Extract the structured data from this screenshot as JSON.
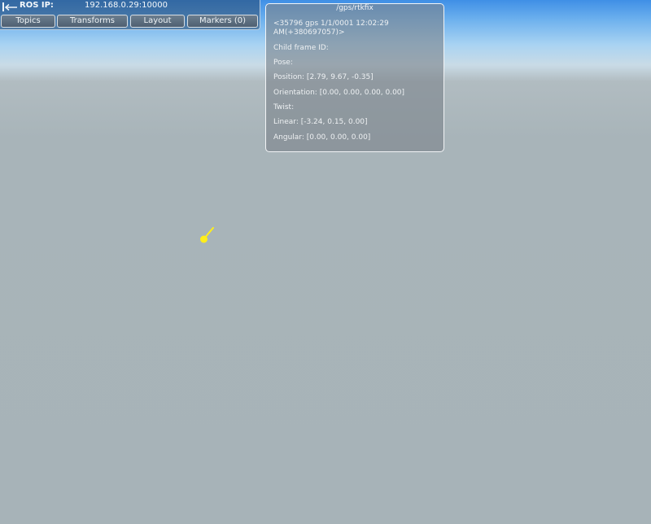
{
  "ros": {
    "label": "ROS IP:",
    "ip": "192.168.0.29:10000",
    "back_icon": "arrow-left-icon"
  },
  "tabs": [
    {
      "label": "Topics"
    },
    {
      "label": "Transforms"
    },
    {
      "label": "Layout"
    },
    {
      "label": "Markers (0)"
    }
  ],
  "message": {
    "title": "/gps/rtkfix",
    "header": "<35796 gps 1/1/0001 12:02:29 AM(+380697057)>",
    "child_frame": "Child frame ID:",
    "pose": "Pose:",
    "position": "Position: [2.79, 9.67, -0.35]",
    "orientation": "Orientation: [0.00, 0.00, 0.00, 0.00]",
    "twist": "Twist:",
    "linear": "Linear: [-3.24, 0.15, 0.00]",
    "angular": "Angular: [0.00, 0.00, 0.00]"
  },
  "colors": {
    "marker": "#ffee1a",
    "sky": "#6fb2ee",
    "ground": "#a7b3b8"
  }
}
